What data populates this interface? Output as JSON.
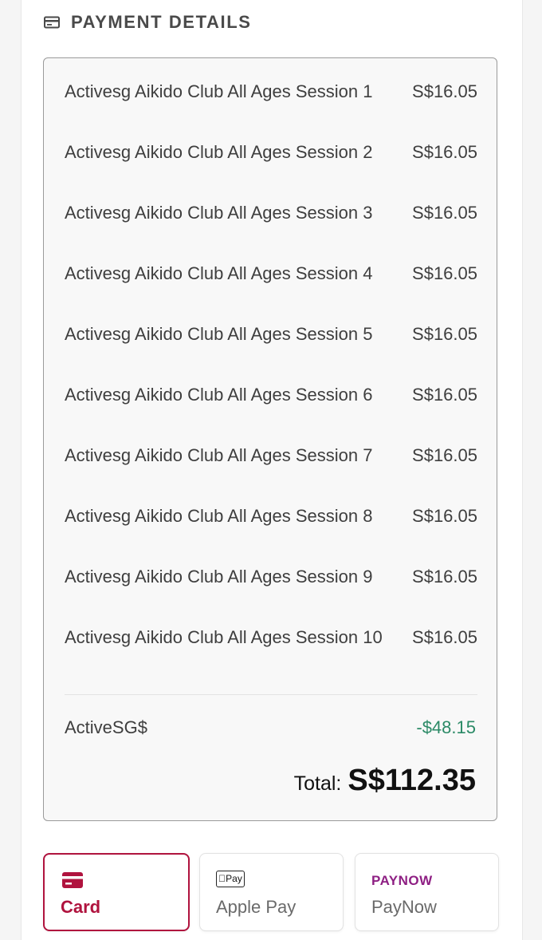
{
  "section": {
    "title": "PAYMENT DETAILS",
    "icon": "credit-card-icon"
  },
  "line_items": [
    {
      "name": "Activesg Aikido Club All Ages Session 1",
      "price": "S$16.05"
    },
    {
      "name": "Activesg Aikido Club All Ages Session 2",
      "price": "S$16.05"
    },
    {
      "name": "Activesg Aikido Club All Ages Session 3",
      "price": "S$16.05"
    },
    {
      "name": "Activesg Aikido Club All Ages Session 4",
      "price": "S$16.05"
    },
    {
      "name": "Activesg Aikido Club All Ages Session 5",
      "price": "S$16.05"
    },
    {
      "name": "Activesg Aikido Club All Ages Session 6",
      "price": "S$16.05"
    },
    {
      "name": "Activesg Aikido Club All Ages Session 7",
      "price": "S$16.05"
    },
    {
      "name": "Activesg Aikido Club All Ages Session 8",
      "price": "S$16.05"
    },
    {
      "name": "Activesg Aikido Club All Ages Session 9",
      "price": "S$16.05"
    },
    {
      "name": "Activesg Aikido Club All Ages Session 10",
      "price": "S$16.05"
    }
  ],
  "credit": {
    "label": "ActiveSG$",
    "value": "-$48.15",
    "color": "#2b8a66"
  },
  "total": {
    "label": "Total:",
    "value": "S$112.35"
  },
  "payment_methods": [
    {
      "label": "Card",
      "icon": "credit-card-icon",
      "selected": true
    },
    {
      "label": "Apple Pay",
      "icon": "apple-pay-icon",
      "badge": "Pay",
      "selected": false
    },
    {
      "label": "PayNow",
      "icon": "paynow-logo",
      "logo_text": "PAYNOW",
      "selected": false
    }
  ],
  "colors": {
    "accent": "#b0133e",
    "paynow": "#8e1f83"
  }
}
